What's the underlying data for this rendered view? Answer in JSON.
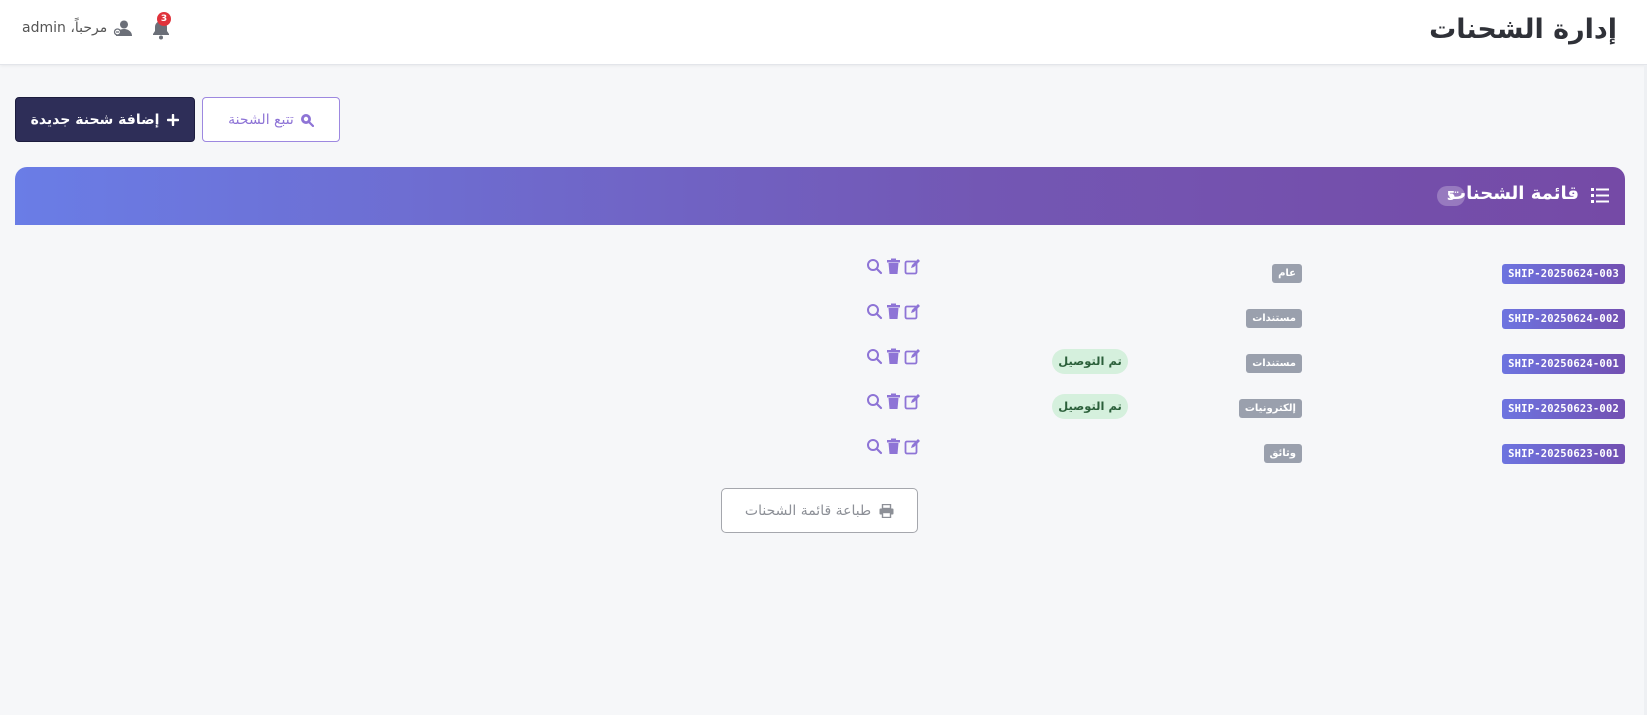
{
  "header": {
    "title": "إدارة الشحنات",
    "greeting": "مرحباً، admin",
    "notifications_count": "3"
  },
  "toolbar": {
    "add_label": "إضافة شحنة جديدة",
    "track_label": "تتبع الشحنة"
  },
  "panel": {
    "title": "قائمة الشحنات",
    "count": "5"
  },
  "shipments": [
    {
      "id": "SHIP-20250624-003",
      "category": "عام",
      "status": ""
    },
    {
      "id": "SHIP-20250624-002",
      "category": "مستندات",
      "status": ""
    },
    {
      "id": "SHIP-20250624-001",
      "category": "مستندات",
      "status": "تم التوصيل"
    },
    {
      "id": "SHIP-20250623-002",
      "category": "إلكترونيات",
      "status": "تم التوصيل"
    },
    {
      "id": "SHIP-20250623-001",
      "category": "وثائق",
      "status": ""
    }
  ],
  "footer": {
    "print_label": "طباعة قائمة الشحنات"
  },
  "colors": {
    "accent": "#7357b4",
    "primary_dark": "#2e2e58",
    "status_delivered_bg": "#d5f0dd"
  },
  "icons": {
    "user": "user-icon",
    "bell": "bell-icon",
    "plus": "plus-icon",
    "search": "search-icon",
    "list": "list-icon",
    "edit": "edit-icon",
    "delete": "trash-icon",
    "view": "magnifier-icon",
    "print": "printer-icon"
  }
}
